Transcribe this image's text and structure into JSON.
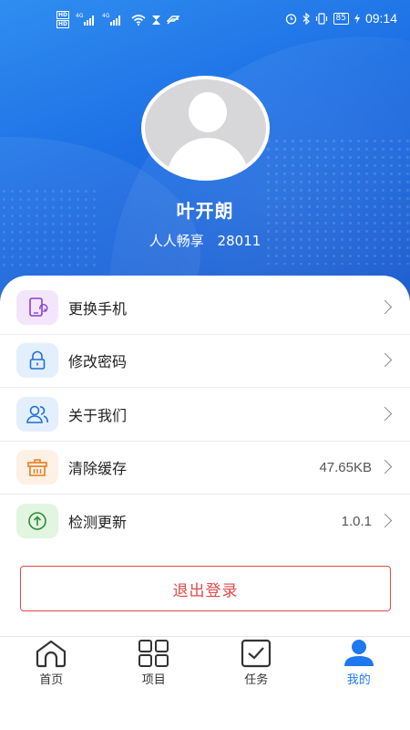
{
  "status_bar": {
    "hd_top": "HD",
    "hd_bottom": "HD",
    "net1": "4G",
    "net2": "4G",
    "battery": "85",
    "time": "09:14"
  },
  "profile": {
    "name": "叶开朗",
    "org": "人人畅享",
    "id": "28011"
  },
  "menu": {
    "items": [
      {
        "label": "更换手机",
        "value": "",
        "icon": "phone-swap-icon",
        "color": "#7c3aed"
      },
      {
        "label": "修改密码",
        "value": "",
        "icon": "lock-icon",
        "color": "#1e78f0"
      },
      {
        "label": "关于我们",
        "value": "",
        "icon": "users-icon",
        "color": "#1e78f0"
      },
      {
        "label": "清除缓存",
        "value": "47.65KB",
        "icon": "trash-basket-icon",
        "color": "#f08a24"
      },
      {
        "label": "检测更新",
        "value": "1.0.1",
        "icon": "upload-circle-icon",
        "color": "#2e9b3e"
      }
    ]
  },
  "logout_label": "退出登录",
  "tabs": [
    {
      "label": "首页",
      "icon": "home-icon"
    },
    {
      "label": "项目",
      "icon": "grid-icon"
    },
    {
      "label": "任务",
      "icon": "checkbox-icon"
    },
    {
      "label": "我的",
      "icon": "person-icon"
    }
  ],
  "colors": {
    "header_blue": "#1d6fe4",
    "active_tab": "#1e78f0",
    "logout_red": "#e04a4a"
  }
}
